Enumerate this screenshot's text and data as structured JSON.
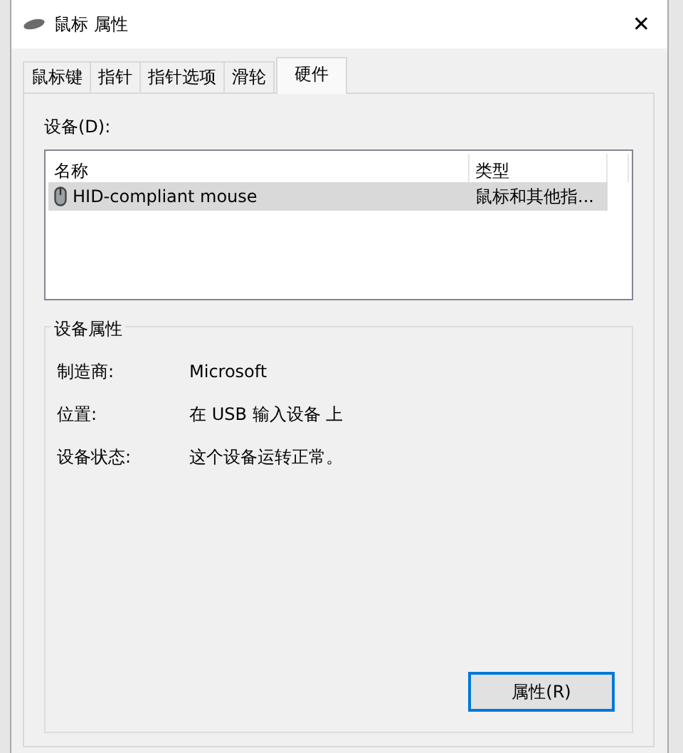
{
  "window": {
    "title": "鼠标 属性",
    "close": "✕"
  },
  "tabs": [
    {
      "label": "鼠标键",
      "selected": false
    },
    {
      "label": "指针",
      "selected": false
    },
    {
      "label": "指针选项",
      "selected": false
    },
    {
      "label": "滑轮",
      "selected": false
    },
    {
      "label": "硬件",
      "selected": true
    }
  ],
  "devices": {
    "label": "设备(D):",
    "columns": [
      "名称",
      "类型"
    ],
    "rows": [
      {
        "name": "HID-compliant mouse",
        "type": "鼠标和其他指...",
        "selected": true
      }
    ]
  },
  "device_properties": {
    "title": "设备属性",
    "fields": [
      {
        "label": "制造商:",
        "value": "Microsoft"
      },
      {
        "label": "位置:",
        "value": "在 USB 输入设备 上"
      },
      {
        "label": "设备状态:",
        "value": "这个设备运转正常。"
      }
    ]
  },
  "buttons": [
    {
      "label": "属性(R)",
      "focused": true
    }
  ]
}
